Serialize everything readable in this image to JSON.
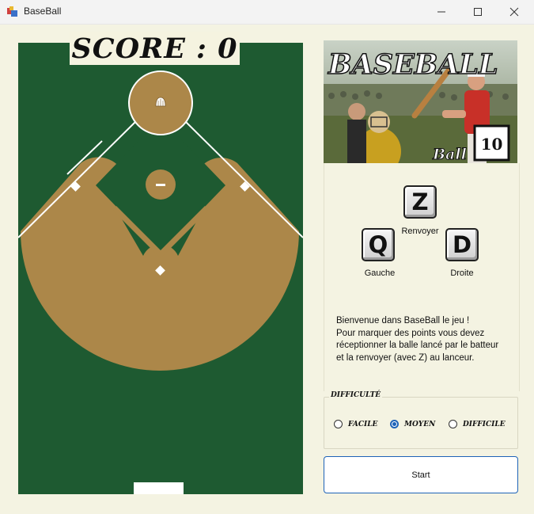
{
  "window": {
    "title": "BaseBall",
    "icons": {
      "app": "app-icon",
      "minimize": "minimize-icon",
      "maximize": "maximize-icon",
      "close": "close-icon"
    }
  },
  "score": {
    "label": "SCORE :  0"
  },
  "logo": {
    "title": "BASEBALL",
    "ball_word": "Ball",
    "balls_count": "10"
  },
  "controls": {
    "up": {
      "key": "Z",
      "label": "Renvoyer"
    },
    "left": {
      "key": "Q",
      "label": "Gauche"
    },
    "right": {
      "key": "D",
      "label": "Droite"
    }
  },
  "intro": {
    "line1": "Bienvenue dans BaseBall le jeu !",
    "line2": "Pour marquer des points vous devez",
    "line3": "réceptionner la balle lancé par le batteur",
    "line4": "et la renvoyer (avec Z) au lanceur."
  },
  "difficulty": {
    "legend": "DIFFICULTÉ",
    "options": [
      {
        "label": "FACILE",
        "selected": false
      },
      {
        "label": "MOYEN",
        "selected": true
      },
      {
        "label": "DIFFICILE",
        "selected": false
      }
    ]
  },
  "start_button": {
    "label": "Start"
  },
  "colors": {
    "grass": "#1e5a31",
    "dirt": "#ac8749",
    "background": "#f4f3e2",
    "accent": "#1e63b8"
  }
}
